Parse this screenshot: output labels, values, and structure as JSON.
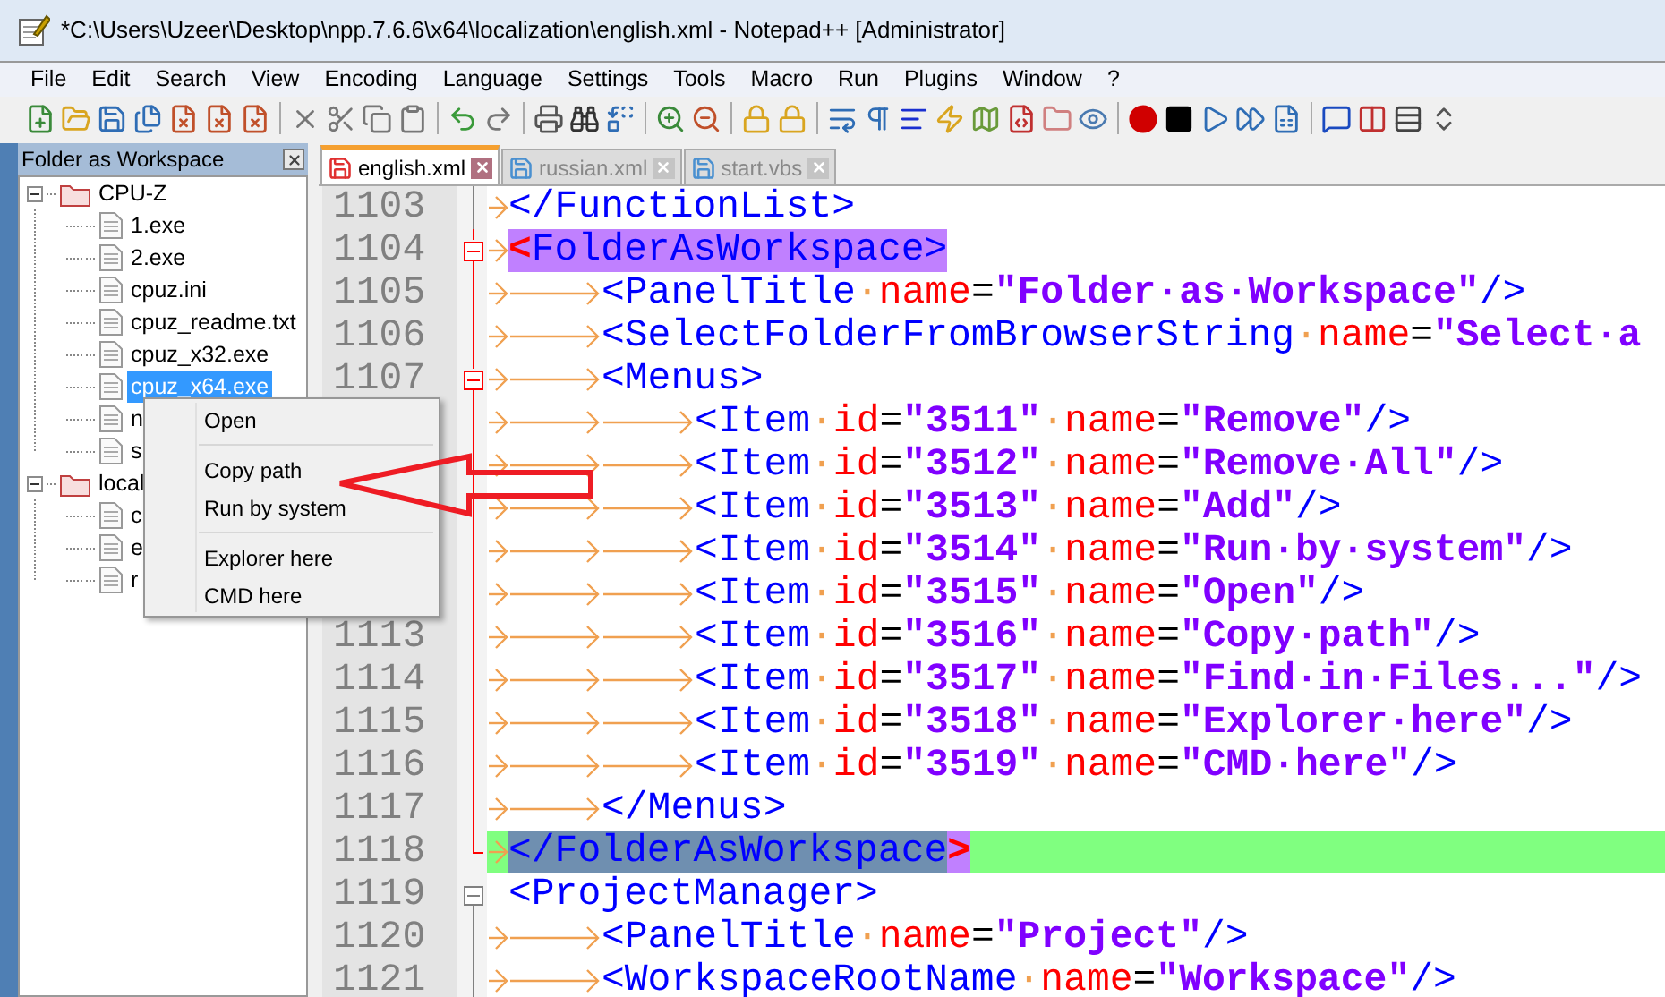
{
  "window": {
    "title": "*C:\\Users\\Uzeer\\Desktop\\npp.7.6.6\\x64\\localization\\english.xml - Notepad++ [Administrator]"
  },
  "menu": [
    "File",
    "Edit",
    "Search",
    "View",
    "Encoding",
    "Language",
    "Settings",
    "Tools",
    "Macro",
    "Run",
    "Plugins",
    "Window",
    "?"
  ],
  "panel": {
    "title": "Folder as Workspace",
    "tree": [
      {
        "label": "CPU-Z",
        "kind": "folder",
        "expanded": true,
        "selected": false,
        "children": [
          {
            "label": "1.exe",
            "kind": "file",
            "selected": false
          },
          {
            "label": "2.exe",
            "kind": "file",
            "selected": false
          },
          {
            "label": "cpuz.ini",
            "kind": "file",
            "selected": false
          },
          {
            "label": "cpuz_readme.txt",
            "kind": "file",
            "selected": false
          },
          {
            "label": "cpuz_x32.exe",
            "kind": "file",
            "selected": false
          },
          {
            "label": "cpuz_x64.exe",
            "kind": "file",
            "selected": true
          },
          {
            "label": "n",
            "kind": "file",
            "selected": false
          },
          {
            "label": "s",
            "kind": "file",
            "selected": false
          }
        ]
      },
      {
        "label": "local",
        "kind": "folder",
        "expanded": true,
        "selected": false,
        "children": [
          {
            "label": "c",
            "kind": "file",
            "selected": false
          },
          {
            "label": "e",
            "kind": "file",
            "selected": false
          },
          {
            "label": "r",
            "kind": "file",
            "selected": false
          }
        ]
      }
    ]
  },
  "tabs": [
    {
      "label": "english.xml",
      "selected": true,
      "modified": true
    },
    {
      "label": "russian.xml",
      "selected": false,
      "modified": false
    },
    {
      "label": "start.vbs",
      "selected": false,
      "modified": false
    }
  ],
  "editor": {
    "lines": [
      {
        "number": "1103",
        "fold": {
          "kind": "body",
          "active": false
        },
        "current": false,
        "tokens": [
          {
            "kind": "tab"
          },
          {
            "kind": "tag",
            "text": "</FunctionList>"
          }
        ]
      },
      {
        "number": "1104",
        "fold": {
          "kind": "open",
          "active": true
        },
        "current": false,
        "tokens": [
          {
            "kind": "tab"
          },
          {
            "kind": "brace",
            "text": "<",
            "match": true
          },
          {
            "kind": "tag",
            "text": "FolderAsWorkspace>",
            "match": true
          }
        ]
      },
      {
        "number": "1105",
        "fold": {
          "kind": "body",
          "active": true
        },
        "current": false,
        "tokens": [
          {
            "kind": "tab"
          },
          {
            "kind": "tab"
          },
          {
            "kind": "tag",
            "text": "<PanelTitle"
          },
          {
            "kind": "space",
            "text": "·"
          },
          {
            "kind": "attr",
            "text": "name"
          },
          {
            "kind": "punct",
            "text": "="
          },
          {
            "kind": "value",
            "text": "\"Folder·as·Workspace\""
          },
          {
            "kind": "tag",
            "text": "/>"
          }
        ]
      },
      {
        "number": "1106",
        "fold": {
          "kind": "body",
          "active": true
        },
        "current": false,
        "tokens": [
          {
            "kind": "tab"
          },
          {
            "kind": "tab"
          },
          {
            "kind": "tag",
            "text": "<SelectFolderFromBrowserString"
          },
          {
            "kind": "space",
            "text": "·"
          },
          {
            "kind": "attr",
            "text": "name"
          },
          {
            "kind": "punct",
            "text": "="
          },
          {
            "kind": "value",
            "text": "\"Select·a"
          }
        ]
      },
      {
        "number": "1107",
        "fold": {
          "kind": "open",
          "active": true
        },
        "current": false,
        "tokens": [
          {
            "kind": "tab"
          },
          {
            "kind": "tab"
          },
          {
            "kind": "tag",
            "text": "<Menus>"
          }
        ]
      },
      {
        "fold": {
          "kind": "body",
          "active": true
        },
        "current": false,
        "tokens": [
          {
            "kind": "tab"
          },
          {
            "kind": "tab"
          },
          {
            "kind": "tab"
          },
          {
            "kind": "tag",
            "text": "<Item"
          },
          {
            "kind": "space",
            "text": "·"
          },
          {
            "kind": "attr",
            "text": "id"
          },
          {
            "kind": "punct",
            "text": "="
          },
          {
            "kind": "value",
            "text": "\"3511\""
          },
          {
            "kind": "space",
            "text": "·"
          },
          {
            "kind": "attr",
            "text": "name"
          },
          {
            "kind": "punct",
            "text": "="
          },
          {
            "kind": "value",
            "text": "\"Remove\""
          },
          {
            "kind": "tag",
            "text": "/>"
          }
        ]
      },
      {
        "fold": {
          "kind": "body",
          "active": true
        },
        "current": false,
        "tokens": [
          {
            "kind": "tab"
          },
          {
            "kind": "tab"
          },
          {
            "kind": "tab"
          },
          {
            "kind": "tag",
            "text": "<Item"
          },
          {
            "kind": "space",
            "text": "·"
          },
          {
            "kind": "attr",
            "text": "id"
          },
          {
            "kind": "punct",
            "text": "="
          },
          {
            "kind": "value",
            "text": "\"3512\""
          },
          {
            "kind": "space",
            "text": "·"
          },
          {
            "kind": "attr",
            "text": "name"
          },
          {
            "kind": "punct",
            "text": "="
          },
          {
            "kind": "value",
            "text": "\"Remove·All\""
          },
          {
            "kind": "tag",
            "text": "/>"
          }
        ]
      },
      {
        "fold": {
          "kind": "body",
          "active": true
        },
        "current": false,
        "tokens": [
          {
            "kind": "tab"
          },
          {
            "kind": "tab"
          },
          {
            "kind": "tab"
          },
          {
            "kind": "tag",
            "text": "<Item"
          },
          {
            "kind": "space",
            "text": "·"
          },
          {
            "kind": "attr",
            "text": "id"
          },
          {
            "kind": "punct",
            "text": "="
          },
          {
            "kind": "value",
            "text": "\"3513\""
          },
          {
            "kind": "space",
            "text": "·"
          },
          {
            "kind": "attr",
            "text": "name"
          },
          {
            "kind": "punct",
            "text": "="
          },
          {
            "kind": "value",
            "text": "\"Add\""
          },
          {
            "kind": "tag",
            "text": "/>"
          }
        ]
      },
      {
        "fold": {
          "kind": "body",
          "active": true
        },
        "current": false,
        "tokens": [
          {
            "kind": "tab"
          },
          {
            "kind": "tab"
          },
          {
            "kind": "tab"
          },
          {
            "kind": "tag",
            "text": "<Item"
          },
          {
            "kind": "space",
            "text": "·"
          },
          {
            "kind": "attr",
            "text": "id"
          },
          {
            "kind": "punct",
            "text": "="
          },
          {
            "kind": "value",
            "text": "\"3514\""
          },
          {
            "kind": "space",
            "text": "·"
          },
          {
            "kind": "attr",
            "text": "name"
          },
          {
            "kind": "punct",
            "text": "="
          },
          {
            "kind": "value",
            "text": "\"Run·by·system\""
          },
          {
            "kind": "tag",
            "text": "/>"
          }
        ]
      },
      {
        "fold": {
          "kind": "body",
          "active": true
        },
        "current": false,
        "tokens": [
          {
            "kind": "tab"
          },
          {
            "kind": "tab"
          },
          {
            "kind": "tab"
          },
          {
            "kind": "tag",
            "text": "<Item"
          },
          {
            "kind": "space",
            "text": "·"
          },
          {
            "kind": "attr",
            "text": "id"
          },
          {
            "kind": "punct",
            "text": "="
          },
          {
            "kind": "value",
            "text": "\"3515\""
          },
          {
            "kind": "space",
            "text": "·"
          },
          {
            "kind": "attr",
            "text": "name"
          },
          {
            "kind": "punct",
            "text": "="
          },
          {
            "kind": "value",
            "text": "\"Open\""
          },
          {
            "kind": "tag",
            "text": "/>"
          }
        ]
      },
      {
        "number": "1113",
        "fold": {
          "kind": "body",
          "active": true
        },
        "current": false,
        "tokens": [
          {
            "kind": "tab"
          },
          {
            "kind": "tab"
          },
          {
            "kind": "tab"
          },
          {
            "kind": "tag",
            "text": "<Item"
          },
          {
            "kind": "space",
            "text": "·"
          },
          {
            "kind": "attr",
            "text": "id"
          },
          {
            "kind": "punct",
            "text": "="
          },
          {
            "kind": "value",
            "text": "\"3516\""
          },
          {
            "kind": "space",
            "text": "·"
          },
          {
            "kind": "attr",
            "text": "name"
          },
          {
            "kind": "punct",
            "text": "="
          },
          {
            "kind": "value",
            "text": "\"Copy·path\""
          },
          {
            "kind": "tag",
            "text": "/>"
          }
        ]
      },
      {
        "number": "1114",
        "fold": {
          "kind": "body",
          "active": true
        },
        "current": false,
        "tokens": [
          {
            "kind": "tab"
          },
          {
            "kind": "tab"
          },
          {
            "kind": "tab"
          },
          {
            "kind": "tag",
            "text": "<Item"
          },
          {
            "kind": "space",
            "text": "·"
          },
          {
            "kind": "attr",
            "text": "id"
          },
          {
            "kind": "punct",
            "text": "="
          },
          {
            "kind": "value",
            "text": "\"3517\""
          },
          {
            "kind": "space",
            "text": "·"
          },
          {
            "kind": "attr",
            "text": "name"
          },
          {
            "kind": "punct",
            "text": "="
          },
          {
            "kind": "value",
            "text": "\"Find·in·Files...\""
          },
          {
            "kind": "tag",
            "text": "/>"
          }
        ]
      },
      {
        "number": "1115",
        "fold": {
          "kind": "body",
          "active": true
        },
        "current": false,
        "tokens": [
          {
            "kind": "tab"
          },
          {
            "kind": "tab"
          },
          {
            "kind": "tab"
          },
          {
            "kind": "tag",
            "text": "<Item"
          },
          {
            "kind": "space",
            "text": "·"
          },
          {
            "kind": "attr",
            "text": "id"
          },
          {
            "kind": "punct",
            "text": "="
          },
          {
            "kind": "value",
            "text": "\"3518\""
          },
          {
            "kind": "space",
            "text": "·"
          },
          {
            "kind": "attr",
            "text": "name"
          },
          {
            "kind": "punct",
            "text": "="
          },
          {
            "kind": "value",
            "text": "\"Explorer·here\""
          },
          {
            "kind": "tag",
            "text": "/>"
          }
        ]
      },
      {
        "number": "1116",
        "fold": {
          "kind": "body",
          "active": true
        },
        "current": false,
        "tokens": [
          {
            "kind": "tab"
          },
          {
            "kind": "tab"
          },
          {
            "kind": "tab"
          },
          {
            "kind": "tag",
            "text": "<Item"
          },
          {
            "kind": "space",
            "text": "·"
          },
          {
            "kind": "attr",
            "text": "id"
          },
          {
            "kind": "punct",
            "text": "="
          },
          {
            "kind": "value",
            "text": "\"3519\""
          },
          {
            "kind": "space",
            "text": "·"
          },
          {
            "kind": "attr",
            "text": "name"
          },
          {
            "kind": "punct",
            "text": "="
          },
          {
            "kind": "value",
            "text": "\"CMD·here\""
          },
          {
            "kind": "tag",
            "text": "/>"
          }
        ]
      },
      {
        "number": "1117",
        "fold": {
          "kind": "body",
          "active": true
        },
        "current": false,
        "tokens": [
          {
            "kind": "tab"
          },
          {
            "kind": "tab"
          },
          {
            "kind": "tag",
            "text": "</Menus>"
          }
        ]
      },
      {
        "number": "1118",
        "fold": {
          "kind": "end",
          "active": true
        },
        "current": true,
        "tokens": [
          {
            "kind": "tab"
          },
          {
            "kind": "selection",
            "text": "</FolderAsWorkspace"
          },
          {
            "kind": "brace",
            "text": ">",
            "match": true
          }
        ]
      },
      {
        "number": "1119",
        "fold": {
          "kind": "open",
          "active": false
        },
        "current": false,
        "tokens": [
          {
            "kind": "tag",
            "text": "<ProjectManager>"
          }
        ]
      },
      {
        "number": "1120",
        "fold": {
          "kind": "body",
          "active": false
        },
        "current": false,
        "tokens": [
          {
            "kind": "tab"
          },
          {
            "kind": "tab"
          },
          {
            "kind": "tag",
            "text": "<PanelTitle"
          },
          {
            "kind": "space",
            "text": "·"
          },
          {
            "kind": "attr",
            "text": "name"
          },
          {
            "kind": "punct",
            "text": "="
          },
          {
            "kind": "value",
            "text": "\"Project\""
          },
          {
            "kind": "tag",
            "text": "/>"
          }
        ]
      },
      {
        "number": "1121",
        "fold": {
          "kind": "body",
          "active": false
        },
        "current": false,
        "tokens": [
          {
            "kind": "tab"
          },
          {
            "kind": "tab"
          },
          {
            "kind": "tag",
            "text": "<WorkspaceRootName"
          },
          {
            "kind": "space",
            "text": "·"
          },
          {
            "kind": "attr",
            "text": "name"
          },
          {
            "kind": "punct",
            "text": "="
          },
          {
            "kind": "value",
            "text": "\"Workspace\""
          },
          {
            "kind": "tag",
            "text": "/>"
          }
        ]
      }
    ]
  },
  "context_menu": {
    "items": [
      {
        "kind": "item",
        "label": "Open"
      },
      {
        "kind": "separator"
      },
      {
        "kind": "item",
        "label": "Copy path"
      },
      {
        "kind": "item",
        "label": "Run by system"
      },
      {
        "kind": "separator"
      },
      {
        "kind": "item",
        "label": "Explorer here"
      },
      {
        "kind": "item",
        "label": "CMD here"
      }
    ]
  }
}
